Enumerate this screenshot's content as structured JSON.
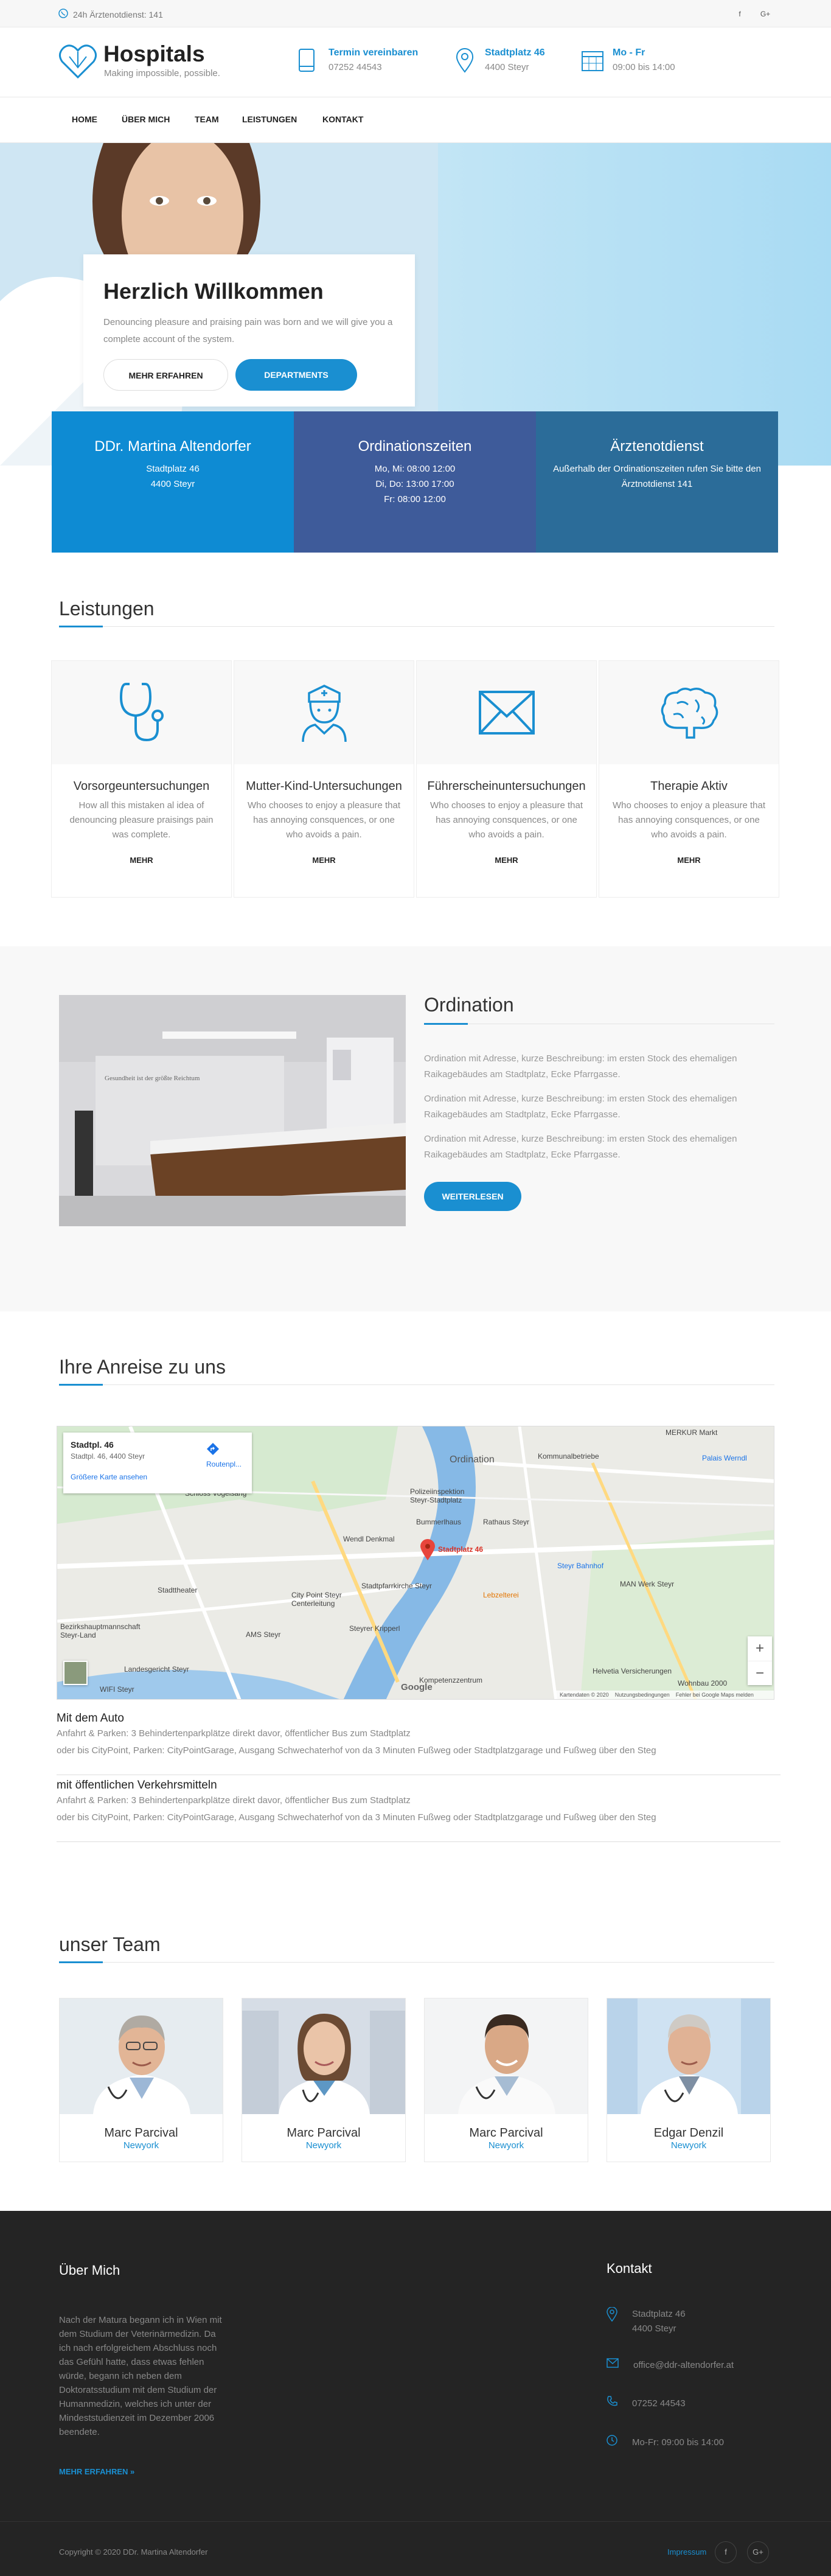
{
  "topbar": {
    "phone": "24h Ärztenotdienst: 141",
    "social": [
      "f",
      "G+"
    ]
  },
  "header": {
    "logo_title": "Hospitals",
    "logo_sub": "Making impossible, possible.",
    "info": [
      {
        "icon": "tablet-icon",
        "title": "Termin vereinbaren",
        "sub": "07252 44543"
      },
      {
        "icon": "location-pin-icon",
        "title": "Stadtplatz 46",
        "sub": "4400 Steyr"
      },
      {
        "icon": "calendar-icon",
        "title": "Mo - Fr",
        "sub": "09:00 bis 14:00"
      }
    ]
  },
  "nav": [
    "HOME",
    "ÜBER MICH",
    "TEAM",
    "LEISTUNGEN",
    "KONTAKT"
  ],
  "hero": {
    "title": "Herzlich Willkommen",
    "text": "Denouncing pleasure and praising pain was born and we will give you a complete account of the system.",
    "btn1": "MEHR ERFAHREN",
    "btn2": "DEPARTMENTS"
  },
  "boxes": [
    {
      "title": "DDr. Martina Altendorfer",
      "lines": [
        "Stadtplatz 46",
        "4400 Steyr"
      ],
      "color": "#0e8bd3"
    },
    {
      "title": "Ordinationszeiten",
      "lines": [
        "Mo, Mi: 08:00  12:00",
        "Di, Do: 13:00  17:00",
        "Fr: 08:00  12:00"
      ],
      "color": "#3e5b9a"
    },
    {
      "title": "Ärztenotdienst",
      "lines": [
        "Außerhalb der Ordinationszeiten rufen Sie bitte den Ärztnotdienst 141"
      ],
      "color": "#2b6c99"
    }
  ],
  "services": {
    "title": "Leistungen",
    "items": [
      {
        "icon": "stethoscope-icon",
        "title": "Vorsorgeuntersuchungen",
        "text": "How all this mistaken al idea of denouncing pleasure praisings pain was complete.",
        "more": "MEHR"
      },
      {
        "icon": "nurse-icon",
        "title": "Mutter-Kind-Untersuchungen",
        "text": "Who chooses to enjoy a pleasure that has annoying consquences, or one who avoids a pain.",
        "more": "MEHR"
      },
      {
        "icon": "envelope-icon",
        "title": "Führerscheinuntersuchungen",
        "text": "Who chooses to enjoy a pleasure that has annoying consquences, or one who avoids a pain.",
        "more": "MEHR"
      },
      {
        "icon": "brain-icon",
        "title": "Therapie Aktiv",
        "text": "Who chooses to enjoy a pleasure that has annoying consquences, or one who avoids a pain.",
        "more": "MEHR"
      }
    ]
  },
  "ordination": {
    "title": "Ordination",
    "paras": [
      "Ordination mit Adresse, kurze Beschreibung: im ersten Stock des ehemaligen Raikagebäudes am Stadtplatz, Ecke Pfarrgasse.",
      "Ordination mit Adresse, kurze Beschreibung: im ersten Stock des ehemaligen Raikagebäudes am Stadtplatz, Ecke Pfarrgasse.",
      "Ordination mit Adresse, kurze Beschreibung: im ersten Stock des ehemaligen Raikagebäudes am Stadtplatz, Ecke Pfarrgasse."
    ],
    "btn": "WEITERLESEN",
    "wall_text": "Gesundheit ist der größte Reichtum"
  },
  "travel": {
    "title": "Ihre Anreise zu uns",
    "map": {
      "card_title": "Stadtpl. 46",
      "card_addr": "Stadtpl. 46, 4400 Steyr",
      "card_link": "Größere Karte ansehen",
      "route": "Routenpl...",
      "pin": "Stadtplatz 46",
      "labels": [
        "Ordination",
        "Schloss Vogelsang",
        "Polizeiinspektion Steyr-Stadtplatz",
        "Bummerlhaus",
        "Rathaus Steyr",
        "Wendl Denkmal",
        "Stadtpfarrkirche Steyr",
        "Steyr Bahnhof",
        "City Point Steyr Centerleitung",
        "Stadttheater",
        "AMS Steyr",
        "Bezirkshauptmannschaft Steyr-Land",
        "Landesgericht Steyr",
        "WIFI Steyr",
        "Kompetenzzentrum",
        "Steyrer Kripperl",
        "Helvetia Versicherungen",
        "Wohnbau 2000",
        "MERKUR Markt",
        "Palais Werndl",
        "MAN Werk Steyr",
        "Kommunalbetriebe",
        "Lebzelterei"
      ],
      "footer": [
        "Kartendaten © 2020",
        "Nutzungsbedingungen",
        "Fehler bei Google Maps melden"
      ],
      "zoom_in": "+",
      "zoom_out": "−",
      "brand": "Google"
    },
    "items": [
      {
        "title": "Mit dem Auto",
        "lines": [
          "Anfahrt & Parken: 3 Behindertenparkplätze direkt davor, öffentlicher Bus zum Stadtplatz",
          "oder bis CityPoint, Parken: CityPointGarage, Ausgang Schwechaterhof von da 3 Minuten Fußweg oder Stadtplatzgarage und Fußweg über den Steg"
        ]
      },
      {
        "title": "mit öffentlichen Verkehrsmitteln",
        "lines": [
          "Anfahrt & Parken: 3 Behindertenparkplätze direkt davor, öffentlicher Bus zum Stadtplatz",
          "oder bis CityPoint, Parken: CityPointGarage, Ausgang Schwechaterhof von da 3 Minuten Fußweg oder Stadtplatzgarage und Fußweg über den Steg"
        ]
      }
    ]
  },
  "team": {
    "title": "unser Team",
    "members": [
      {
        "name": "Marc Parcival",
        "city": "Newyork"
      },
      {
        "name": "Marc Parcival",
        "city": "Newyork"
      },
      {
        "name": "Marc Parcival",
        "city": "Newyork"
      },
      {
        "name": "Edgar Denzil",
        "city": "Newyork"
      }
    ]
  },
  "footer": {
    "about_title": "Über Mich",
    "about_text": "Nach der Matura begann ich in Wien mit dem Studium der Veterinärmedizin. Da ich nach erfolgreichem Abschluss noch das Gefühl hatte, dass etwas fehlen würde, begann ich neben dem Doktoratsstudium mit dem Studium der Humanmedizin, welches ich unter der Mindeststudienzeit im Dezember 2006 beendete.",
    "about_link": "MEHR ERFAHREN »",
    "contact_title": "Kontakt",
    "contact": [
      {
        "icon": "location-pin-icon",
        "lines": [
          "Stadtplatz 46",
          "4400 Steyr"
        ]
      },
      {
        "icon": "mail-icon",
        "lines": [
          "office@ddr-altendorfer.at"
        ]
      },
      {
        "icon": "phone-icon",
        "lines": [
          "07252 44543"
        ]
      },
      {
        "icon": "clock-icon",
        "lines": [
          "Mo-Fr: 09:00 bis 14:00"
        ]
      }
    ],
    "copyright": "Copyright © 2020 DDr. Martina Altendorfer",
    "impressum": "Impressum",
    "social": [
      "f",
      "G+"
    ]
  }
}
